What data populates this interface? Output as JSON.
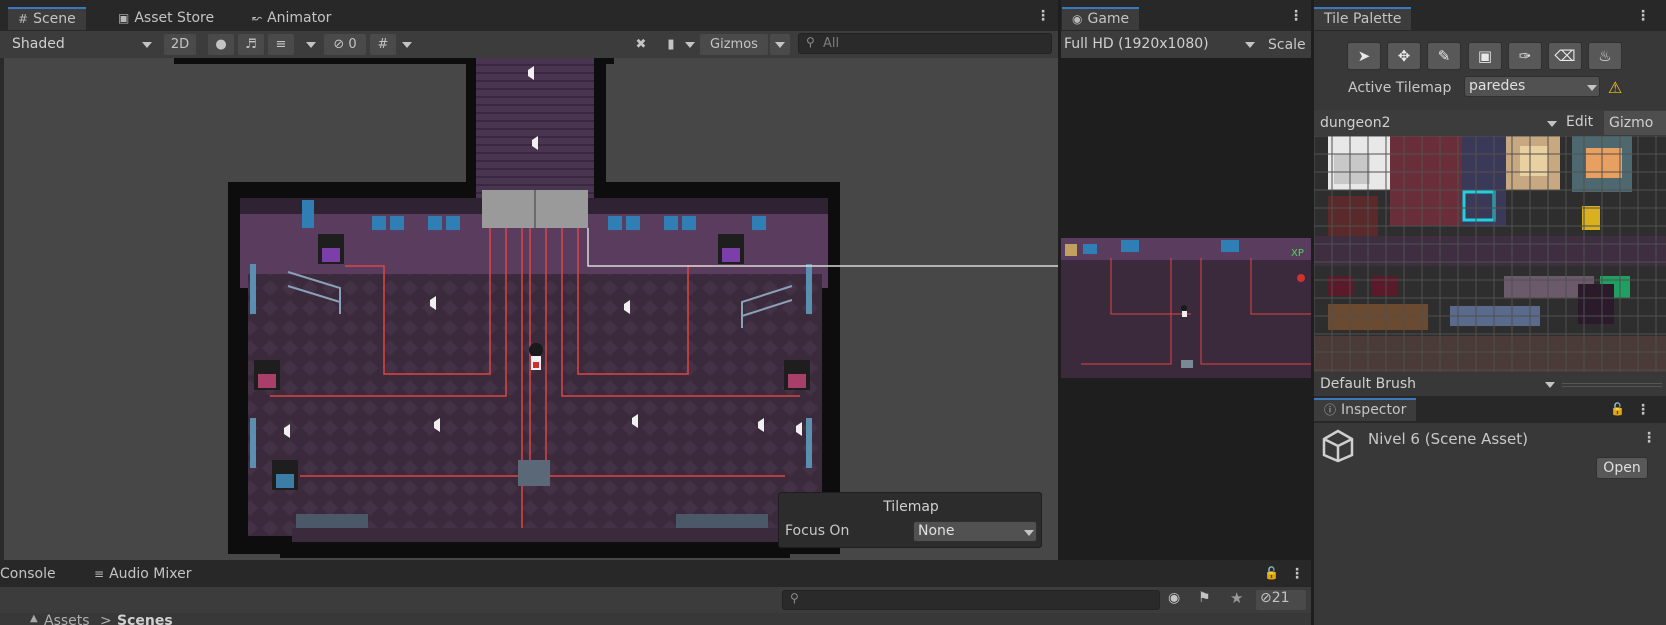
{
  "scene_tabs": {
    "scene": "Scene",
    "asset_store": "Asset Store",
    "animator": "Animator"
  },
  "scene_toolbar": {
    "shading_mode": "Shaded",
    "mode_2d": "2D",
    "hidden_count": "0",
    "gizmos": "Gizmos",
    "search_placeholder": "All"
  },
  "game": {
    "tab": "Game",
    "resolution": "Full HD (1920x1080)",
    "scale_label": "Scale"
  },
  "tile_palette": {
    "tab": "Tile Palette",
    "active_tilemap_label": "Active Tilemap",
    "active_tilemap_value": "paredes",
    "palette_name": "dungeon2",
    "edit_label": "Edit",
    "gizmos_label": "Gizmo",
    "brush": "Default Brush"
  },
  "tilemap_overlay": {
    "title": "Tilemap",
    "focus_label": "Focus On",
    "focus_value": "None"
  },
  "inspector": {
    "tab": "Inspector",
    "asset_name": "Nivel 6 (Scene Asset)",
    "open_button": "Open"
  },
  "bottom": {
    "console_tab": "Console",
    "audio_mixer_tab": "Audio Mixer",
    "hidden_count": "21",
    "breadcrumb_root": "Assets",
    "breadcrumb_sep": ">",
    "breadcrumb_leaf": "Scenes"
  },
  "colors": {
    "accent": "#3a79bb",
    "panel": "#383838",
    "toolbar": "#3c3c3c",
    "floor": "#3a2a3c",
    "wall": "#5a3d5e",
    "laser": "#e04545",
    "warning": "#f0c419"
  }
}
